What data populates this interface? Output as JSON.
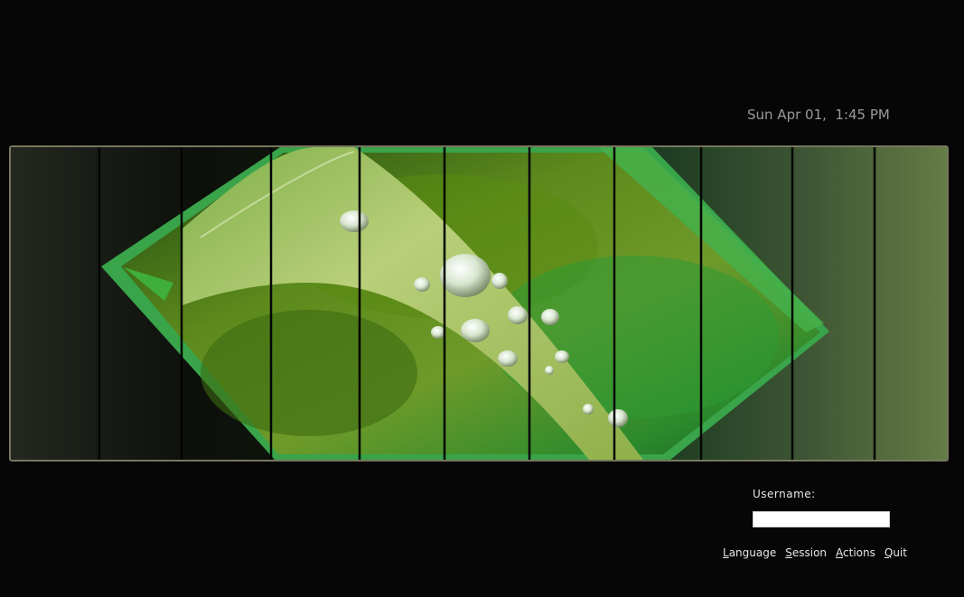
{
  "clock": {
    "text": "Sun Apr 01,  1:45 PM"
  },
  "banner": {
    "description_icon": "grass-blade-dewdrops-wallpaper",
    "colors": {
      "dark_base": "#0f110c",
      "leaf_light": "#b7cf76",
      "leaf_mid": "#7fa83a",
      "foliage": "#2f8f3a",
      "frame": "#77775e"
    }
  },
  "login": {
    "username_label": "Username:",
    "username_value": "",
    "username_placeholder": ""
  },
  "menu": {
    "items": [
      {
        "mnemonic": "L",
        "rest": "anguage"
      },
      {
        "mnemonic": "S",
        "rest": "ession"
      },
      {
        "mnemonic": "A",
        "rest": "ctions"
      },
      {
        "mnemonic": "Q",
        "rest": "uit"
      }
    ]
  }
}
